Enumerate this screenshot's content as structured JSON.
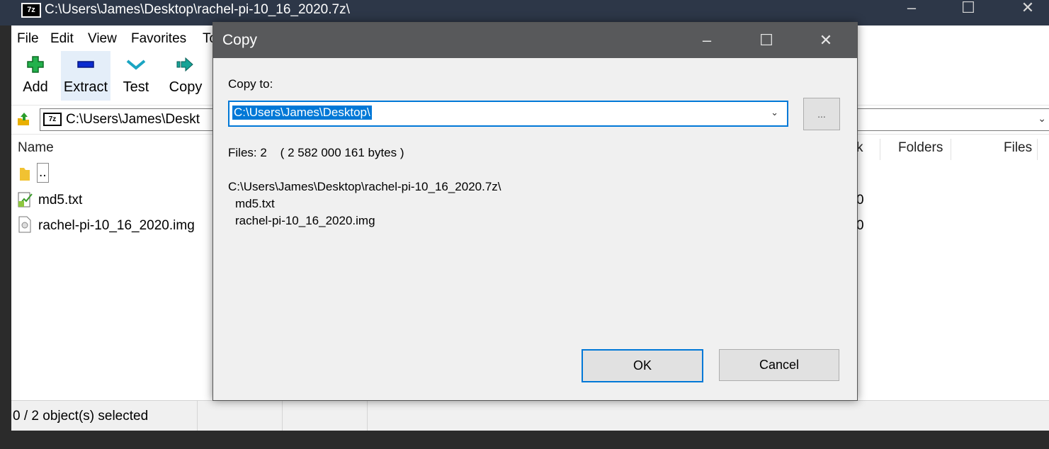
{
  "main_window": {
    "title": "C:\\Users\\James\\Desktop\\rachel-pi-10_16_2020.7z\\",
    "app_icon": "7z-icon",
    "minimize_icon": "minimize-icon",
    "maximize_icon": "maximize-icon",
    "close_icon": "close-icon"
  },
  "menu": {
    "file": "File",
    "edit": "Edit",
    "view": "View",
    "favorites": "Favorites",
    "tools": "To"
  },
  "toolbar": {
    "add": "Add",
    "extract": "Extract",
    "test": "Test",
    "copy": "Copy"
  },
  "address": {
    "path": "C:\\Users\\James\\Deskt"
  },
  "columns": {
    "name": "Name",
    "packed": "k",
    "folders": "Folders",
    "files": "Files"
  },
  "rows": [
    {
      "name": "..",
      "value": ""
    },
    {
      "name": "md5.txt",
      "value": "0"
    },
    {
      "name": "rachel-pi-10_16_2020.img",
      "value": "0"
    }
  ],
  "status": {
    "selection": "0 / 2 object(s) selected"
  },
  "dialog": {
    "title": "Copy",
    "copy_to_label": "Copy to:",
    "destination": "C:\\Users\\James\\Desktop\\",
    "browse_label": "...",
    "files_info": "Files: 2    ( 2 582 000 161 bytes )",
    "source_path": "C:\\Users\\James\\Desktop\\rachel-pi-10_16_2020.7z\\",
    "items": [
      "md5.txt",
      "rachel-pi-10_16_2020.img"
    ],
    "ok": "OK",
    "cancel": "Cancel"
  },
  "colors": {
    "accent": "#0078d7",
    "title_bar": "#2d3748",
    "dialog_title_bar": "#58595b"
  }
}
